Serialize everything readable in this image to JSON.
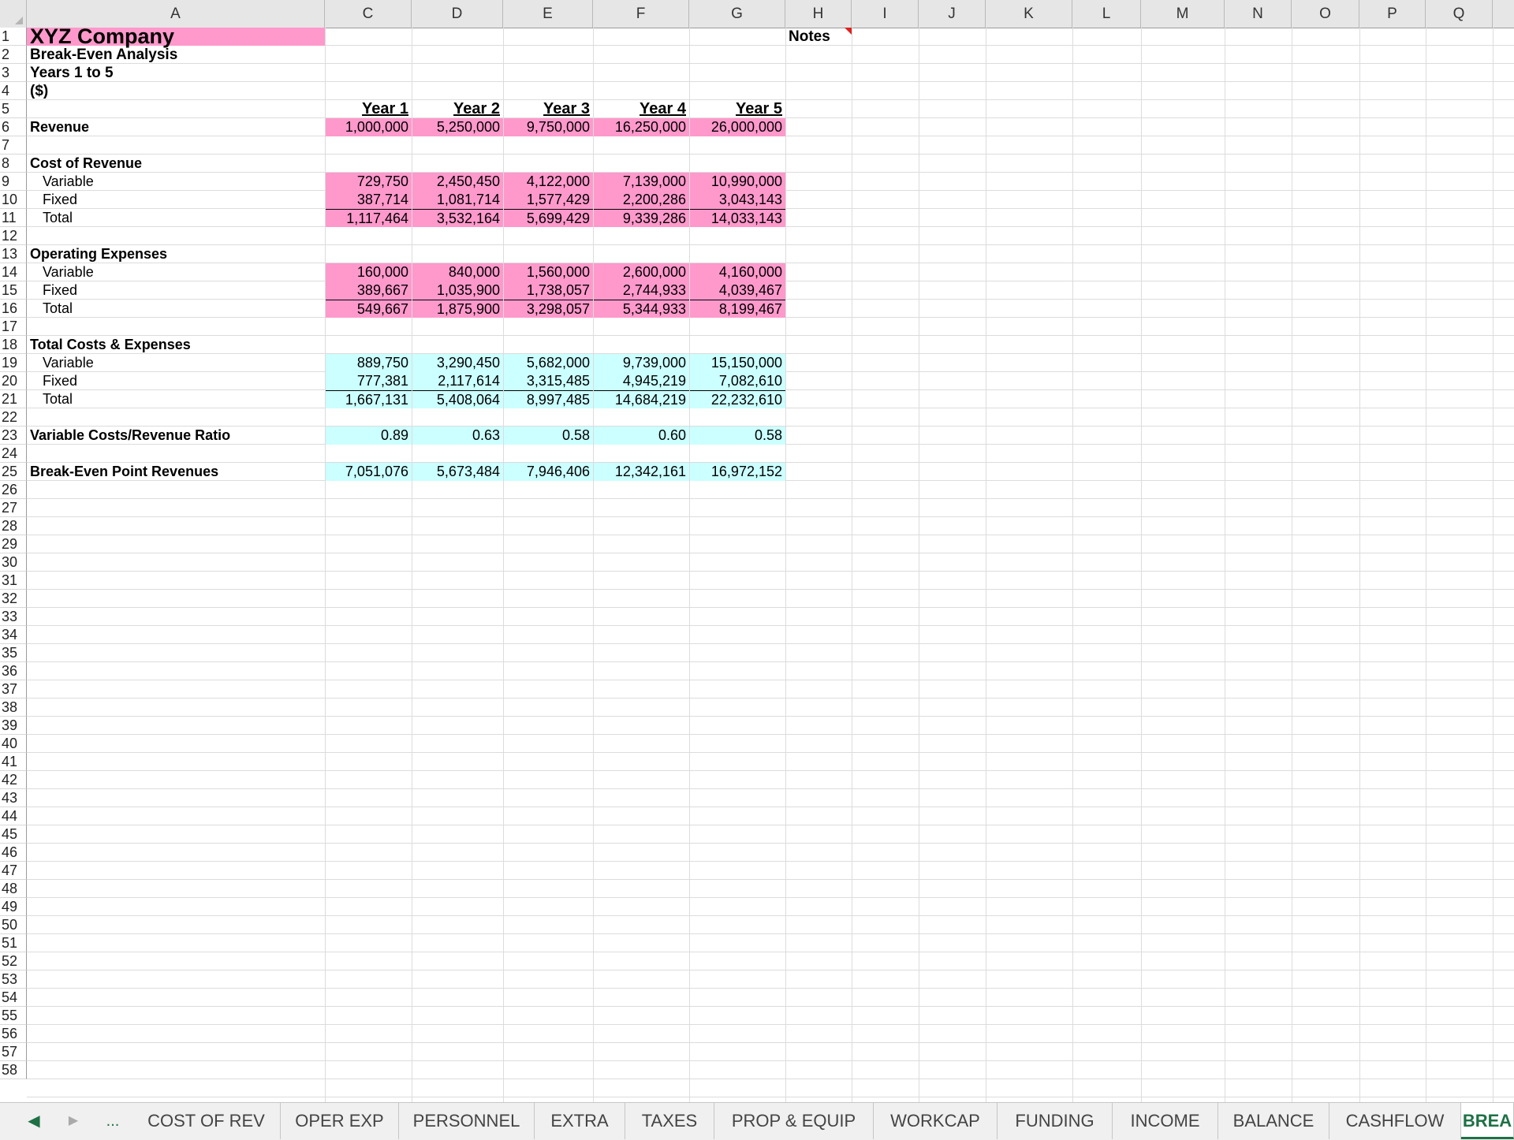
{
  "columns": [
    "A",
    "C",
    "D",
    "E",
    "F",
    "G",
    "H",
    "I",
    "J",
    "K",
    "L",
    "M",
    "N",
    "O",
    "P",
    "Q"
  ],
  "rows": [
    "1",
    "2",
    "3",
    "4",
    "5",
    "6",
    "7",
    "8",
    "9",
    "10",
    "11",
    "12",
    "13",
    "14",
    "15",
    "16",
    "17",
    "18",
    "19",
    "20",
    "21",
    "22",
    "23",
    "24",
    "25",
    "26",
    "27",
    "28",
    "29",
    "30",
    "31",
    "32",
    "33",
    "34",
    "35",
    "36",
    "37",
    "38",
    "39",
    "40",
    "41",
    "42",
    "43",
    "44",
    "45",
    "46",
    "47",
    "48",
    "49",
    "50",
    "51",
    "52",
    "53",
    "54",
    "55",
    "56",
    "57",
    "58"
  ],
  "sheet": {
    "company": "XYZ Company",
    "subtitle": "Break-Even Analysis",
    "period": "Years 1 to 5",
    "units": "($)",
    "notes": "Notes",
    "years": [
      "Year 1",
      "Year 2",
      "Year 3",
      "Year 4",
      "Year 5"
    ],
    "revenue": {
      "label": "Revenue",
      "values": [
        "1,000,000",
        "5,250,000",
        "9,750,000",
        "16,250,000",
        "26,000,000"
      ]
    },
    "cost_of_revenue": {
      "label": "Cost of Revenue",
      "variable": {
        "label": "Variable",
        "values": [
          "729,750",
          "2,450,450",
          "4,122,000",
          "7,139,000",
          "10,990,000"
        ]
      },
      "fixed": {
        "label": "Fixed",
        "values": [
          "387,714",
          "1,081,714",
          "1,577,429",
          "2,200,286",
          "3,043,143"
        ]
      },
      "total": {
        "label": "Total",
        "values": [
          "1,117,464",
          "3,532,164",
          "5,699,429",
          "9,339,286",
          "14,033,143"
        ]
      }
    },
    "operating_expenses": {
      "label": "Operating Expenses",
      "variable": {
        "label": "Variable",
        "values": [
          "160,000",
          "840,000",
          "1,560,000",
          "2,600,000",
          "4,160,000"
        ]
      },
      "fixed": {
        "label": "Fixed",
        "values": [
          "389,667",
          "1,035,900",
          "1,738,057",
          "2,744,933",
          "4,039,467"
        ]
      },
      "total": {
        "label": "Total",
        "values": [
          "549,667",
          "1,875,900",
          "3,298,057",
          "5,344,933",
          "8,199,467"
        ]
      }
    },
    "total_costs": {
      "label": "Total Costs & Expenses",
      "variable": {
        "label": "Variable",
        "values": [
          "889,750",
          "3,290,450",
          "5,682,000",
          "9,739,000",
          "15,150,000"
        ]
      },
      "fixed": {
        "label": "Fixed",
        "values": [
          "777,381",
          "2,117,614",
          "3,315,485",
          "4,945,219",
          "7,082,610"
        ]
      },
      "total": {
        "label": "Total",
        "values": [
          "1,667,131",
          "5,408,064",
          "8,997,485",
          "14,684,219",
          "22,232,610"
        ]
      }
    },
    "ratio": {
      "label": "Variable Costs/Revenue Ratio",
      "values": [
        "0.89",
        "0.63",
        "0.58",
        "0.60",
        "0.58"
      ]
    },
    "breakeven": {
      "label": "Break-Even Point Revenues",
      "values": [
        "7,051,076",
        "5,673,484",
        "7,946,406",
        "12,342,161",
        "16,972,152"
      ]
    }
  },
  "tabs": [
    "COST OF REV",
    "OPER EXP",
    "PERSONNEL",
    "EXTRA",
    "TAXES",
    "PROP & EQUIP",
    "WORKCAP",
    "FUNDING",
    "INCOME",
    "BALANCE",
    "CASHFLOW",
    "BREA"
  ],
  "nav": {
    "prev": "◀",
    "next": "▶",
    "more": "..."
  },
  "colors": {
    "pink": "#ff99cc",
    "cyan": "#ccffff",
    "active_tab": "#1e7145"
  }
}
